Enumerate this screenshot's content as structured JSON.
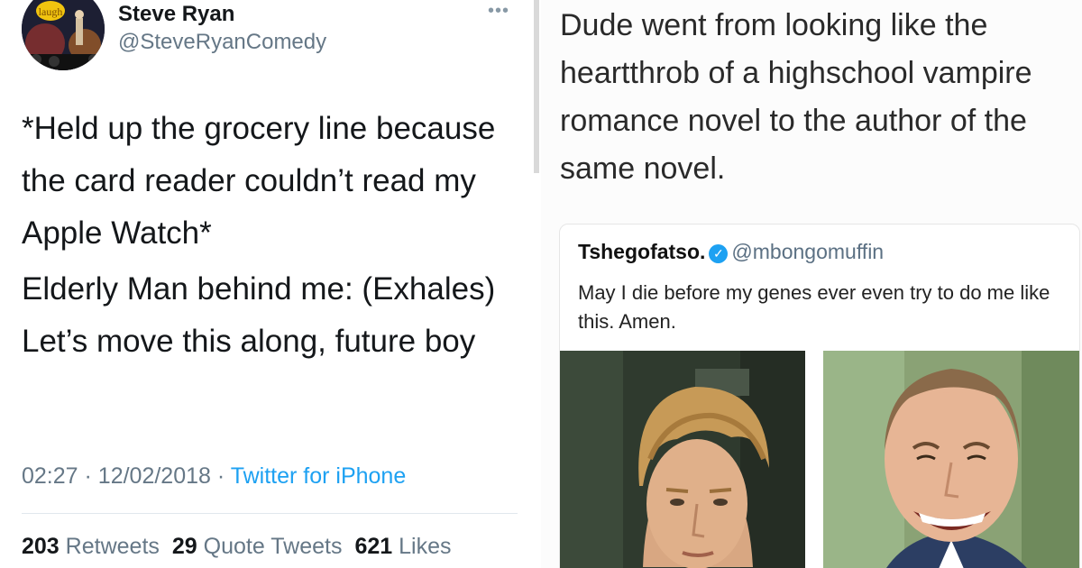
{
  "tweet": {
    "author_name": "Steve Ryan",
    "author_handle": "@SteveRyanComedy",
    "more_icon": "more-dots-icon",
    "paragraphs": [
      "*Held up the grocery line because the card reader couldn’t read my Apple Watch*",
      "Elderly Man behind me: (Exhales) Let’s move this along, future boy"
    ],
    "time": "02:27",
    "date": "12/02/2018",
    "source": "Twitter for iPhone",
    "stats": {
      "retweets_count": "203",
      "retweets_label": "Retweets",
      "quotes_count": "29",
      "quotes_label": "Quote Tweets",
      "likes_count": "621",
      "likes_label": "Likes"
    }
  },
  "meme": {
    "caption": "Dude went from looking like the heartthrob of a highschool vampire romance novel to the author of the same novel.",
    "quote": {
      "name": "Tshegofatso.",
      "verified_icon": "verified-badge-icon",
      "handle": "@mbongomuffin",
      "text": "May I die before my genes ever even try to do me like this. Amen."
    }
  },
  "colors": {
    "twitter_blue": "#1da1f2",
    "secondary_text": "#657786"
  }
}
